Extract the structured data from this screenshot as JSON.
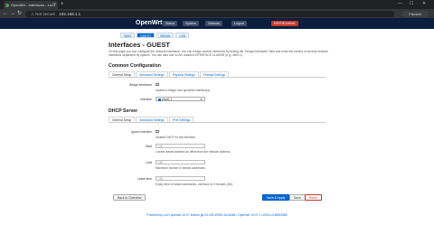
{
  "browser": {
    "tab_title": "OpenWrt - Interfaces - LuCI",
    "tab_close": "×",
    "new_tab": "+",
    "win_min": "—",
    "win_max": "☐",
    "win_close": "✕",
    "back": "←",
    "forward": "→",
    "reload": "↻",
    "not_secure": "⚠ Not secure",
    "url": "192.168.1.1",
    "profile": "Paused"
  },
  "header": {
    "brand": "OpenWrt",
    "menus": [
      "Status",
      "System",
      "Network",
      "Logout"
    ],
    "refresh": "REFRESHING"
  },
  "iface_tabs": [
    "WAN",
    "GUEST",
    "WWAN",
    "LAN"
  ],
  "page": {
    "title": "Interfaces - GUEST",
    "description": "On this page you can configure the network interfaces. You can bridge several interfaces by ticking the \"bridge interfaces\" field and enter the names of several network interfaces separated by spaces. You can also use VLAN notation INTERFACE.VLANNR (e.g.: eth0.1)."
  },
  "common": {
    "heading": "Common Configuration",
    "tabs": [
      "General Setup",
      "Advanced Settings",
      "Physical Settings",
      "Firewall Settings"
    ],
    "bridge_label": "Bridge interfaces",
    "bridge_hint": "creates a bridge over specified interface(s)",
    "interface_label": "Interface",
    "interface_value": "wlan0-1"
  },
  "dhcp": {
    "heading": "DHCP Server",
    "tabs": [
      "General Setup",
      "Advanced Settings",
      "IPv6 Settings"
    ],
    "ignore_label": "Ignore interface",
    "ignore_hint": "Disable DHCP for this interface.",
    "start_label": "Start",
    "start_placeholder": "100",
    "start_hint": "Lowest leased address as offset from the network address.",
    "limit_label": "Limit",
    "limit_placeholder": "150",
    "limit_hint": "Maximum number of leased addresses.",
    "lease_label": "Lease time",
    "lease_placeholder": "12h",
    "lease_hint": "Expiry time of leased addresses, minimum is 2 minutes (2m)."
  },
  "actions": {
    "back": "Back to Overview",
    "save_apply": "Save & Apply",
    "save": "Save",
    "reset": "Reset"
  },
  "footer": "Powered by LuCI openwrt-19.07 branch git-20.029.49392-1b2a3bd / OpenWrt 19.07.1 r10911-c155900f66"
}
